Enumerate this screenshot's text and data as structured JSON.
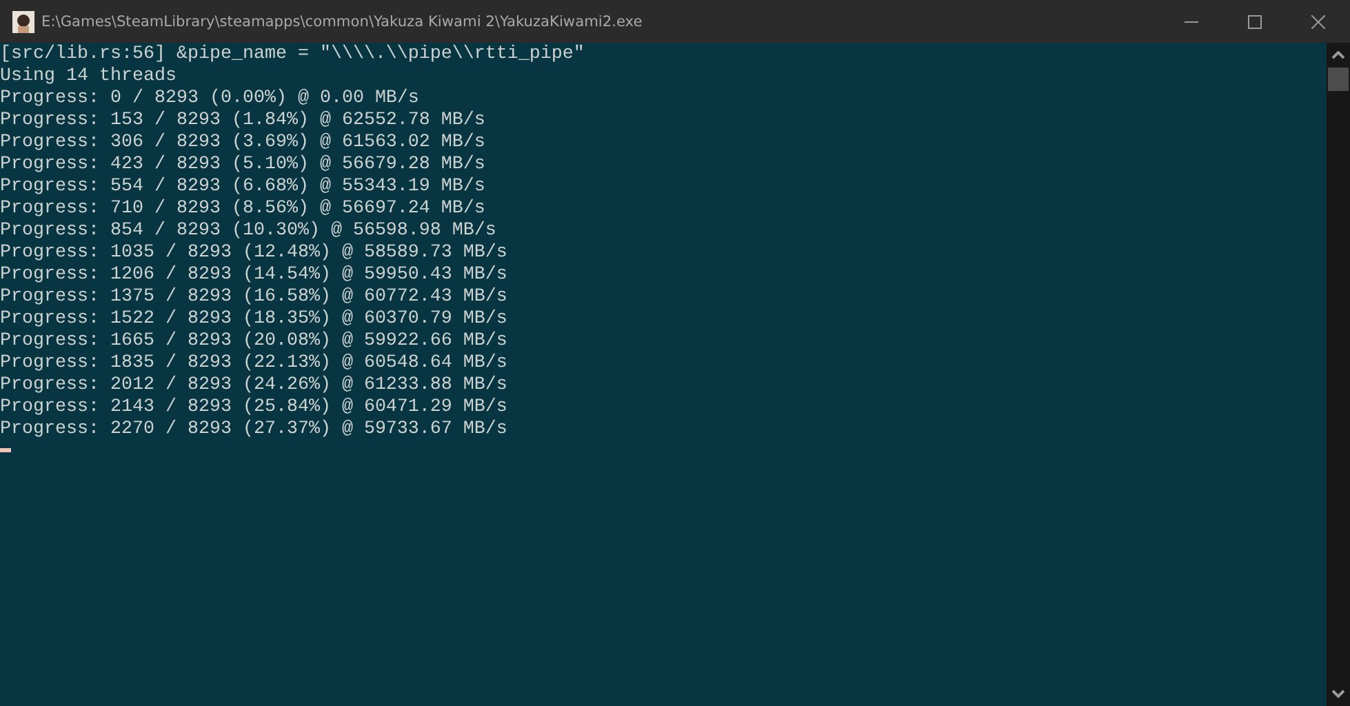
{
  "window": {
    "title": "E:\\Games\\SteamLibrary\\steamapps\\common\\Yakuza Kiwami 2\\YakuzaKiwami2.exe"
  },
  "console": {
    "lines": [
      "[src/lib.rs:56] &pipe_name = \"\\\\\\\\.\\\\pipe\\\\rtti_pipe\"",
      "Using 14 threads",
      "Progress: 0 / 8293 (0.00%) @ 0.00 MB/s",
      "Progress: 153 / 8293 (1.84%) @ 62552.78 MB/s",
      "Progress: 306 / 8293 (3.69%) @ 61563.02 MB/s",
      "Progress: 423 / 8293 (5.10%) @ 56679.28 MB/s",
      "Progress: 554 / 8293 (6.68%) @ 55343.19 MB/s",
      "Progress: 710 / 8293 (8.56%) @ 56697.24 MB/s",
      "Progress: 854 / 8293 (10.30%) @ 56598.98 MB/s",
      "Progress: 1035 / 8293 (12.48%) @ 58589.73 MB/s",
      "Progress: 1206 / 8293 (14.54%) @ 59950.43 MB/s",
      "Progress: 1375 / 8293 (16.58%) @ 60772.43 MB/s",
      "Progress: 1522 / 8293 (18.35%) @ 60370.79 MB/s",
      "Progress: 1665 / 8293 (20.08%) @ 59922.66 MB/s",
      "Progress: 1835 / 8293 (22.13%) @ 60548.64 MB/s",
      "Progress: 2012 / 8293 (24.26%) @ 61233.88 MB/s",
      "Progress: 2143 / 8293 (25.84%) @ 60471.29 MB/s",
      "Progress: 2270 / 8293 (27.37%) @ 59733.67 MB/s"
    ]
  }
}
